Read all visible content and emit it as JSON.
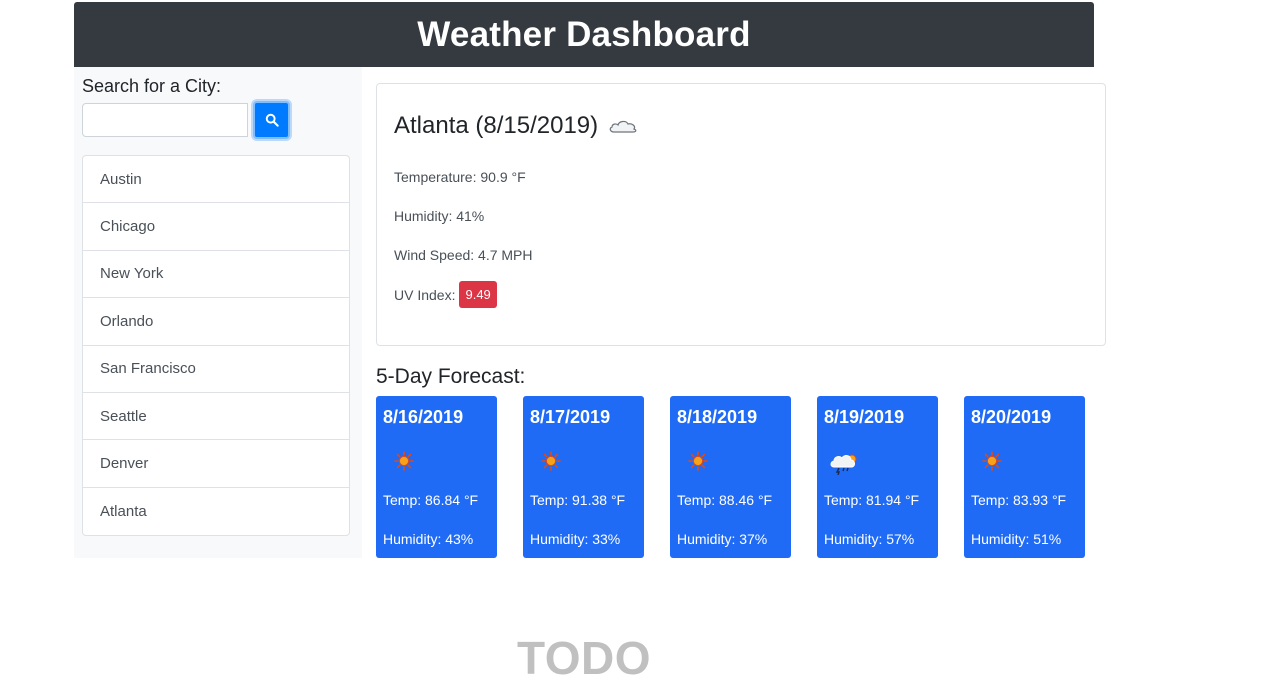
{
  "header": {
    "title": "Weather Dashboard"
  },
  "sidebar": {
    "search_label": "Search for a City:",
    "search_value": "",
    "search_placeholder": "",
    "search_button_icon": "search-icon",
    "cities": [
      "Austin",
      "Chicago",
      "New York",
      "Orlando",
      "San Francisco",
      "Seattle",
      "Denver",
      "Atlanta"
    ]
  },
  "current": {
    "title": "Atlanta (8/15/2019)",
    "icon": "cloud-icon",
    "temperature": "Temperature: 90.9 °F",
    "humidity": "Humidity: 41%",
    "wind": "Wind Speed: 4.7 MPH",
    "uv_label": "UV Index:",
    "uv_value": "9.49",
    "uv_color": "#dc3545"
  },
  "forecast": {
    "heading": "5-Day Forecast:",
    "days": [
      {
        "date": "8/16/2019",
        "icon": "sun-icon",
        "temp": "Temp: 86.84 °F",
        "humidity": "Humidity: 43%"
      },
      {
        "date": "8/17/2019",
        "icon": "sun-icon",
        "temp": "Temp: 91.38 °F",
        "humidity": "Humidity: 33%"
      },
      {
        "date": "8/18/2019",
        "icon": "sun-icon",
        "temp": "Temp: 88.46 °F",
        "humidity": "Humidity: 37%"
      },
      {
        "date": "8/19/2019",
        "icon": "thunderstorm-icon",
        "temp": "Temp: 81.94 °F",
        "humidity": "Humidity: 57%"
      },
      {
        "date": "8/20/2019",
        "icon": "sun-icon",
        "temp": "Temp: 83.93 °F",
        "humidity": "Humidity: 51%"
      }
    ]
  },
  "footer": {
    "todo": "TODO"
  },
  "colors": {
    "header_bg": "#343a40",
    "accent": "#007bff",
    "forecast_card": "#1f6bf5"
  }
}
